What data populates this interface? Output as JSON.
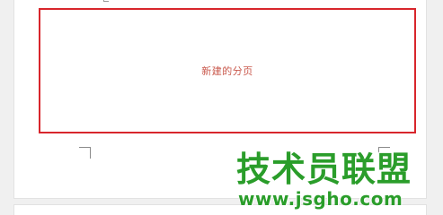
{
  "document": {
    "new_section_label": "新建的分页"
  },
  "watermark": {
    "title": "技术员联盟",
    "url": "www.jsgho.com"
  },
  "colors": {
    "selection_border": "#d8262c",
    "label_text": "#c9584c",
    "watermark_green": "#2a9d2a",
    "canvas_background": "#f0f0f0"
  }
}
